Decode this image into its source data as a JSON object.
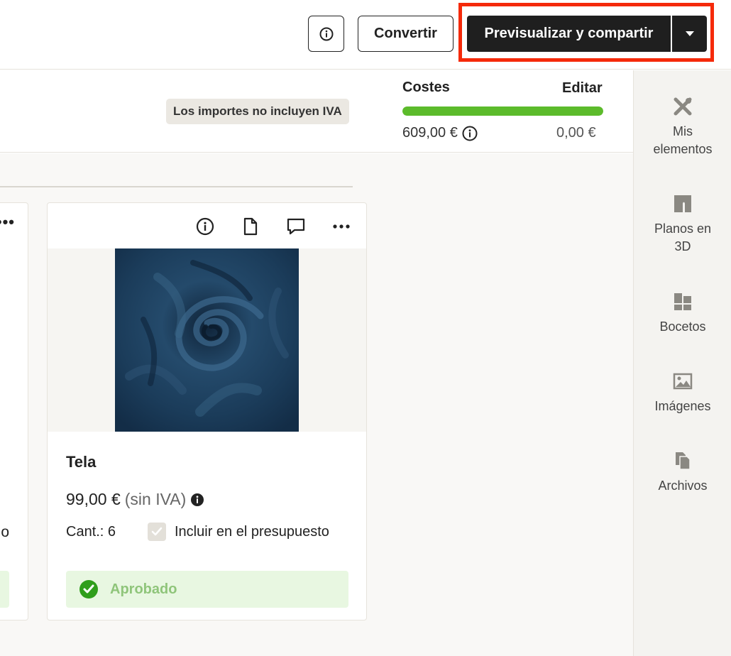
{
  "toolbar": {
    "info_icon": "info-icon",
    "convert_label": "Convertir",
    "preview_label": "Previsualizar y compartir",
    "dropdown_icon": "caret-down-icon",
    "highlight_color": "#f52a0a"
  },
  "costs": {
    "iva_notice": "Los importes no incluyen IVA",
    "title": "Costes",
    "edit_label": "Editar",
    "spent": "609,00 €",
    "budget": "0,00 €",
    "progress_fraction": 1.0,
    "progress_color": "#5cbb2b"
  },
  "card": {
    "title": "Tela",
    "price": "99,00 €",
    "price_suffix": "(sin IVA)",
    "quantity": "Cant.: 6",
    "include_label": "Incluir en el presupuesto",
    "include_checked": true,
    "status_label": "Aprobado",
    "status_color": "#2f9e1b",
    "icons": [
      "info-icon",
      "document-icon",
      "comment-icon",
      "more-icon"
    ]
  },
  "card_left": {
    "more_label": "•••",
    "fragment_text": "o"
  },
  "sidebar": {
    "items": [
      {
        "label_line1": "Mis",
        "label_line2": "elementos",
        "icon": "tools-icon"
      },
      {
        "label_line1": "Planos en",
        "label_line2": "3D",
        "icon": "floorplan-icon"
      },
      {
        "label_line1": "Bocetos",
        "label_line2": "",
        "icon": "sketch-icon"
      },
      {
        "label_line1": "Imágenes",
        "label_line2": "",
        "icon": "image-icon"
      },
      {
        "label_line1": "Archivos",
        "label_line2": "",
        "icon": "files-icon"
      }
    ]
  }
}
